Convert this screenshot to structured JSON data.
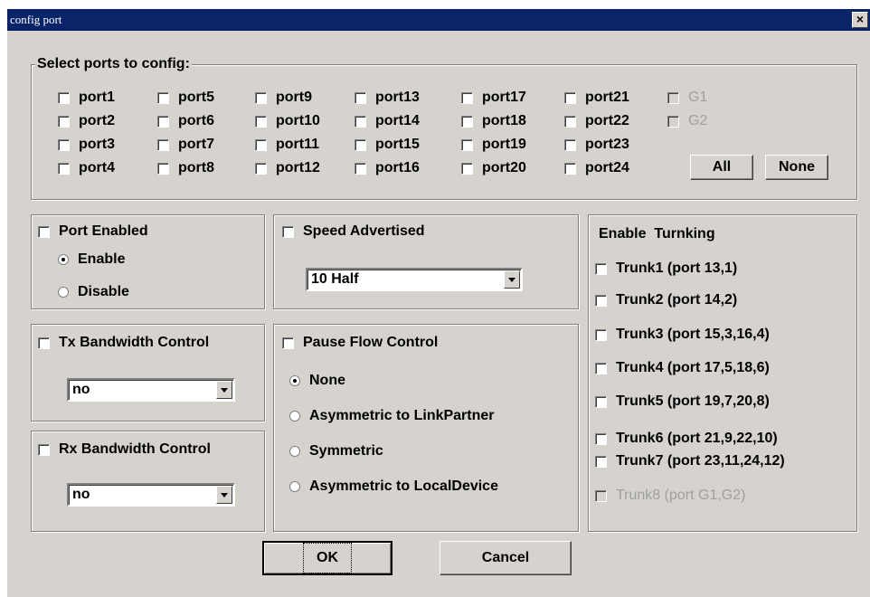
{
  "window": {
    "title": "config port",
    "close_glyph": "×"
  },
  "select_ports": {
    "legend": "Select ports to config:",
    "columns": [
      [
        "port1",
        "port2",
        "port3",
        "port4"
      ],
      [
        "port5",
        "port6",
        "port7",
        "port8"
      ],
      [
        "port9",
        "port10",
        "port11",
        "port12"
      ],
      [
        "port13",
        "port14",
        "port15",
        "port16"
      ],
      [
        "port17",
        "port18",
        "port19",
        "port20"
      ],
      [
        "port21",
        "port22",
        "port23",
        "port24"
      ]
    ],
    "gig_ports": [
      "G1",
      "G2"
    ],
    "all_label": "All",
    "none_label": "None"
  },
  "port_enabled": {
    "label": "Port Enabled",
    "options": [
      "Enable",
      "Disable"
    ],
    "selected": "Enable"
  },
  "speed": {
    "label": "Speed Advertised",
    "value": "10 Half"
  },
  "tx_bw": {
    "label": "Tx Bandwidth Control",
    "value": "no"
  },
  "rx_bw": {
    "label": "Rx Bandwidth Control",
    "value": "no"
  },
  "pause_flow": {
    "label": "Pause Flow Control",
    "options": [
      "None",
      "Asymmetric to LinkPartner",
      "Symmetric",
      "Asymmetric to LocalDevice"
    ],
    "selected": "None"
  },
  "trunking": {
    "heading": "Enable  Turnking",
    "items": [
      "Trunk1 (port 13,1)",
      "Trunk2 (port 14,2)",
      "Trunk3 (port 15,3,16,4)",
      "Trunk4 (port 17,5,18,6)",
      "Trunk5 (port 19,7,20,8)",
      "Trunk6 (port 21,9,22,10)",
      "Trunk7 (port 23,11,24,12)",
      "Trunk8 (port G1,G2)"
    ],
    "disabled_item": "Trunk8 (port G1,G2)"
  },
  "buttons": {
    "ok": "OK",
    "cancel": "Cancel"
  },
  "colors": {
    "dialog_bg": "#d6d3ce",
    "titlebar": "#0a246a",
    "disabled_text": "#a0a0a0"
  }
}
